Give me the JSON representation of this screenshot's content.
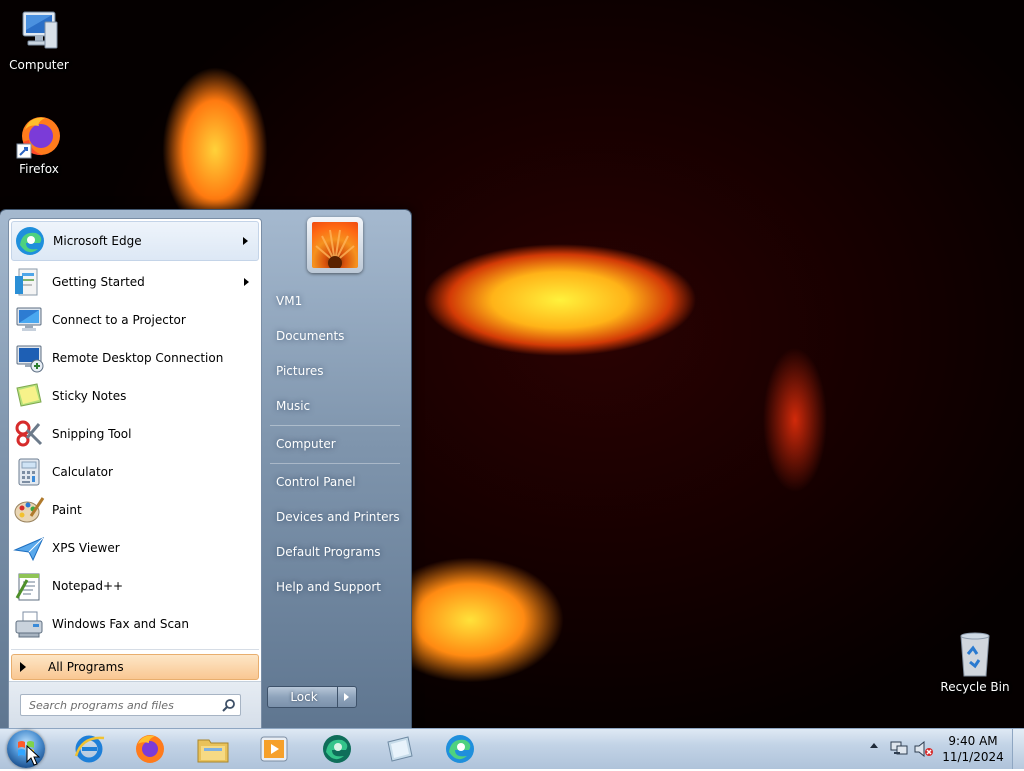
{
  "desktop": {
    "icons": [
      {
        "label": "Computer",
        "icon": "computer-icon"
      },
      {
        "label": "Firefox",
        "icon": "firefox-icon"
      },
      {
        "label": "Recycle Bin",
        "icon": "recycle-bin-icon"
      }
    ]
  },
  "start_menu": {
    "pinned": [
      {
        "label": "Microsoft Edge",
        "icon": "edge-icon",
        "has_submenu": true
      },
      {
        "label": "Getting Started",
        "icon": "getting-started-icon",
        "has_submenu": true
      },
      {
        "label": "Connect to a Projector",
        "icon": "projector-icon",
        "has_submenu": false
      },
      {
        "label": "Remote Desktop Connection",
        "icon": "remote-desktop-icon",
        "has_submenu": false
      },
      {
        "label": "Sticky Notes",
        "icon": "sticky-notes-icon",
        "has_submenu": false
      },
      {
        "label": "Snipping Tool",
        "icon": "snipping-tool-icon",
        "has_submenu": false
      },
      {
        "label": "Calculator",
        "icon": "calculator-icon",
        "has_submenu": false
      },
      {
        "label": "Paint",
        "icon": "paint-icon",
        "has_submenu": false
      },
      {
        "label": "XPS Viewer",
        "icon": "xps-viewer-icon",
        "has_submenu": false
      },
      {
        "label": "Notepad++",
        "icon": "notepad-plus-plus-icon",
        "has_submenu": false
      },
      {
        "label": "Windows Fax and Scan",
        "icon": "fax-scan-icon",
        "has_submenu": false
      }
    ],
    "all_programs_label": "All Programs",
    "search": {
      "placeholder": "Search programs and files"
    },
    "right_links": [
      {
        "label": "VM1"
      },
      {
        "label": "Documents"
      },
      {
        "label": "Pictures"
      },
      {
        "label": "Music"
      },
      {
        "label": "Computer"
      },
      {
        "label": "Control Panel"
      },
      {
        "label": "Devices and Printers"
      },
      {
        "label": "Default Programs"
      },
      {
        "label": "Help and Support"
      }
    ],
    "lock_label": "Lock"
  },
  "taskbar": {
    "pinned": [
      {
        "icon": "internet-explorer-icon"
      },
      {
        "icon": "firefox-icon"
      },
      {
        "icon": "file-explorer-icon"
      },
      {
        "icon": "media-player-icon"
      },
      {
        "icon": "edge-dev-icon"
      },
      {
        "icon": "notes-app-icon"
      },
      {
        "icon": "edge-icon"
      }
    ],
    "clock": {
      "time": "9:40 AM",
      "date": "11/1/2024"
    }
  }
}
